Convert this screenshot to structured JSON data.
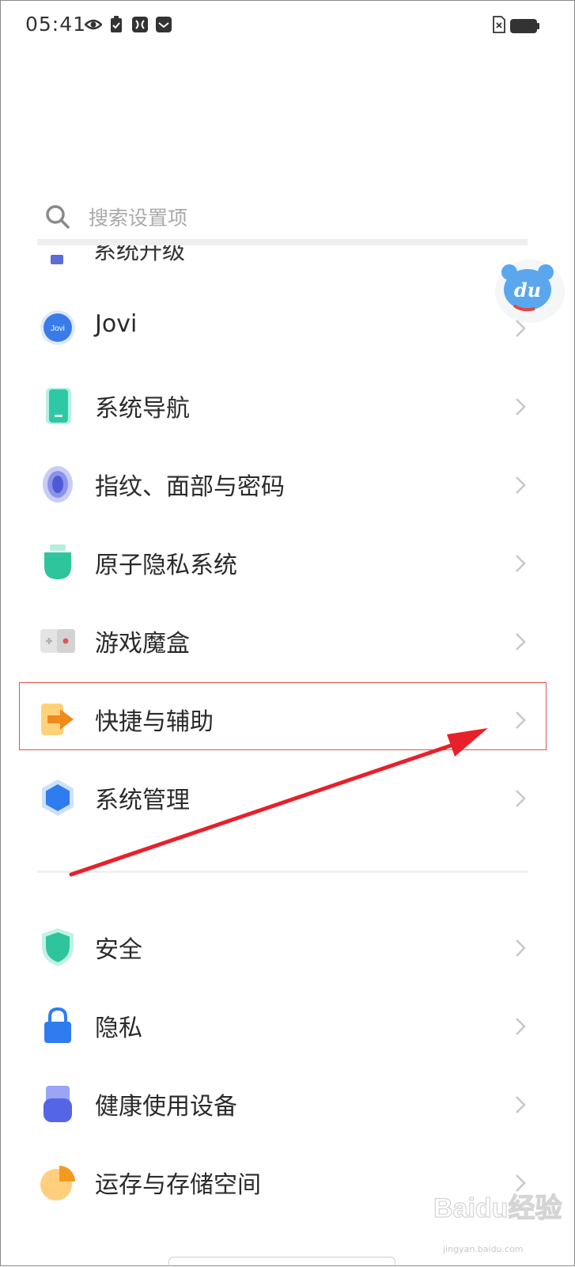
{
  "status_bar": {
    "time": "05:41",
    "icons": [
      "eye-icon",
      "clipboard-check-icon",
      "media-icon",
      "mail-box-icon",
      "sim-off-icon",
      "battery-icon"
    ]
  },
  "search": {
    "placeholder": "搜索设置项",
    "icon": "search-icon"
  },
  "partial_item": {
    "label": "系统升级"
  },
  "settings": {
    "items": [
      {
        "label": "Jovi",
        "icon": "jovi-icon",
        "icon_text": "Jovi"
      },
      {
        "label": "系统导航",
        "icon": "phone-navigation-icon"
      },
      {
        "label": "指纹、面部与密码",
        "icon": "fingerprint-icon"
      },
      {
        "label": "原子隐私系统",
        "icon": "privacy-shield-icon"
      },
      {
        "label": "游戏魔盒",
        "icon": "gamepad-icon"
      },
      {
        "label": "快捷与辅助",
        "icon": "shortcut-arrow-icon"
      },
      {
        "label": "系统管理",
        "icon": "hexagon-icon"
      }
    ],
    "items2": [
      {
        "label": "安全",
        "icon": "security-shield-icon"
      },
      {
        "label": "隐私",
        "icon": "lock-icon"
      },
      {
        "label": "健康使用设备",
        "icon": "health-usage-icon"
      },
      {
        "label": "运存与存储空间",
        "icon": "storage-pie-icon"
      }
    ]
  },
  "badge": {
    "text": "du",
    "icon": "du-bear-icon"
  },
  "watermark": {
    "text": "Baidu经验",
    "url_text": "jingyan.baidu.com"
  },
  "colors": {
    "highlight_border": "#e8504a",
    "annotation_arrow": "#e8202a",
    "chevron": "#c8c8c8"
  }
}
